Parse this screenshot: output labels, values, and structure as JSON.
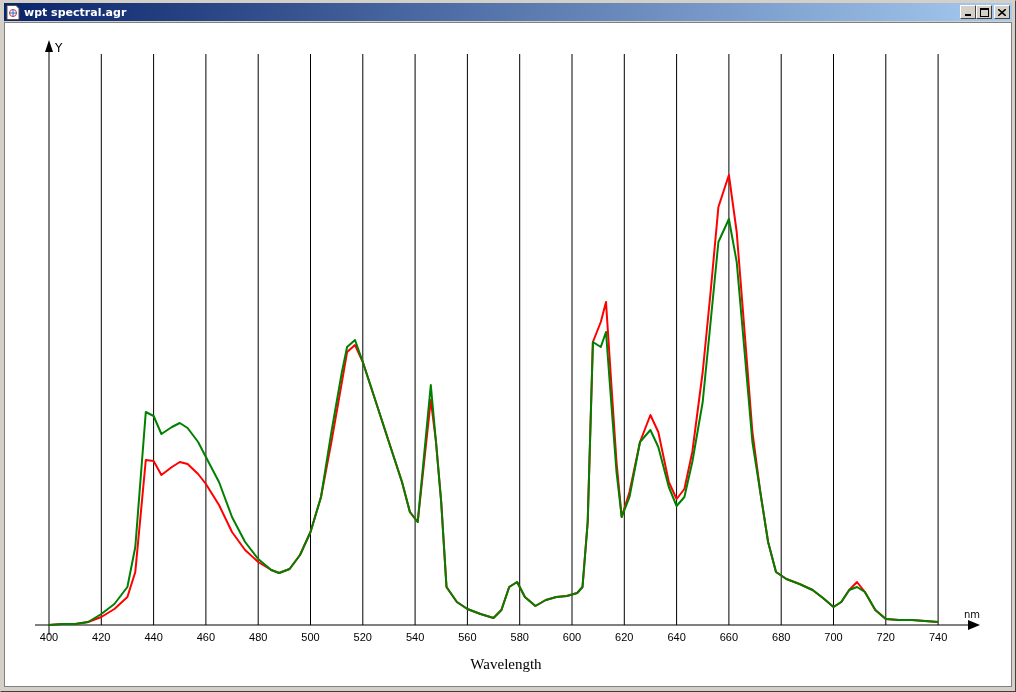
{
  "window": {
    "title": "wpt spectral.agr"
  },
  "chart": {
    "y_axis_label": "Y",
    "x_unit": "nm",
    "x_title": "Wavelength",
    "x_ticks": [
      "400",
      "420",
      "440",
      "460",
      "480",
      "500",
      "520",
      "540",
      "560",
      "580",
      "600",
      "620",
      "640",
      "660",
      "680",
      "700",
      "720",
      "740"
    ],
    "curves": [
      {
        "color": "#ff0000"
      },
      {
        "color": "#008000"
      }
    ]
  }
}
